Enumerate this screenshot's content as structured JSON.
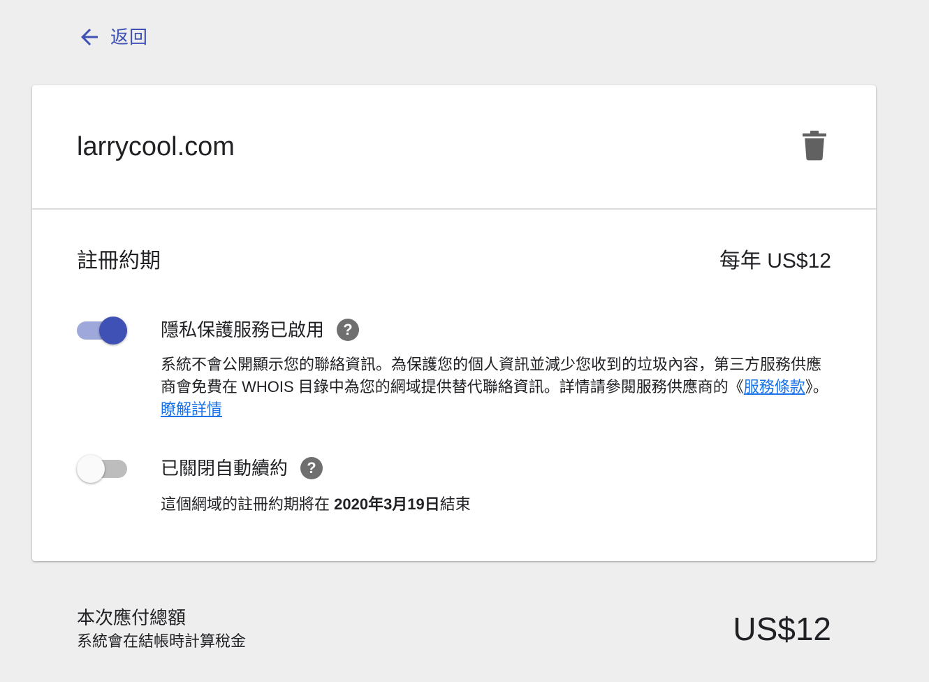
{
  "nav": {
    "back_label": "返回"
  },
  "domain": {
    "name": "larrycool.com"
  },
  "registration": {
    "term_label": "註冊約期",
    "price": "每年 US$12"
  },
  "privacy": {
    "title": "隱私保護服務已啟用",
    "enabled": true,
    "desc_text": "系統不會公開顯示您的聯絡資訊。為保護您的個人資訊並減少您收到的垃圾內容，第三方服務供應商會免費在 WHOIS 目錄中為您的網域提供替代聯絡資訊。詳情請參閱服務供應商的《",
    "terms_link": "服務條款",
    "desc_mid": "》。",
    "learn_more_link": "瞭解詳情"
  },
  "auto_renew": {
    "title": "已關閉自動續約",
    "enabled": false,
    "desc_prefix": "這個網域的註冊約期將在 ",
    "end_date": "2020年3月19日",
    "desc_suffix": "結束"
  },
  "total": {
    "label": "本次應付總額",
    "tax_note": "系統會在結帳時計算稅金",
    "amount": "US$12"
  },
  "colors": {
    "accent": "#3f51b5",
    "link": "#1a73e8",
    "background": "#eeeeee"
  },
  "icons": {
    "back": "arrow-left-icon",
    "delete": "trash-icon",
    "help": "help-circle-icon"
  }
}
